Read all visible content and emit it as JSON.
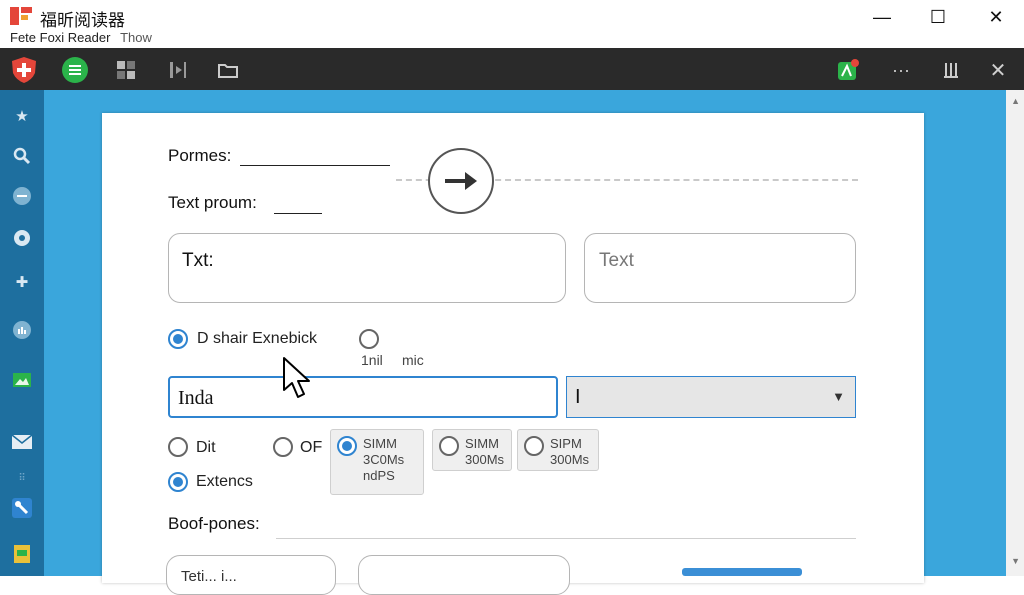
{
  "window": {
    "title": "福昕阅读器",
    "subtitle_main": "Fete Foxi Reader",
    "subtitle_dim": "Thow",
    "minimize": "—",
    "maximize": "☐",
    "close": "✕"
  },
  "toolbar": {
    "more": "···",
    "close": "✕",
    "accent_red": "#e4463a",
    "accent_green": "#2bb34a"
  },
  "colors": {
    "toolbar_bg": "#2a2a2a",
    "sidebar_bg": "#1e6f9f",
    "workspace_bg": "#3aa6dc",
    "focus_blue": "#2f84d0"
  },
  "form": {
    "field1_label": "Pormes:",
    "field2_label": "Text proum:",
    "box1_text": "Txt:",
    "box2_text": "Text",
    "radio1_label": "D shair Exnebick",
    "radio2_sub_a": "1nil",
    "radio2_sub_b": "mic",
    "input_value": "Inda",
    "select_value": "I",
    "select_arrow": "▼",
    "opt_dit": "Dit",
    "opt_of": "OF",
    "chip1_line1": "SIMM",
    "chip1_line2": "3C0Ms",
    "chip1_line3": "ndPS",
    "chip2_line1": "SIMM",
    "chip2_line2": "300Ms",
    "chip3_line1": "SIPM",
    "chip3_line2": "300Ms",
    "opt_extencs": "Extencs",
    "section_label": "Boof-pones:",
    "bottom_text_partial": "Teti... i..."
  }
}
